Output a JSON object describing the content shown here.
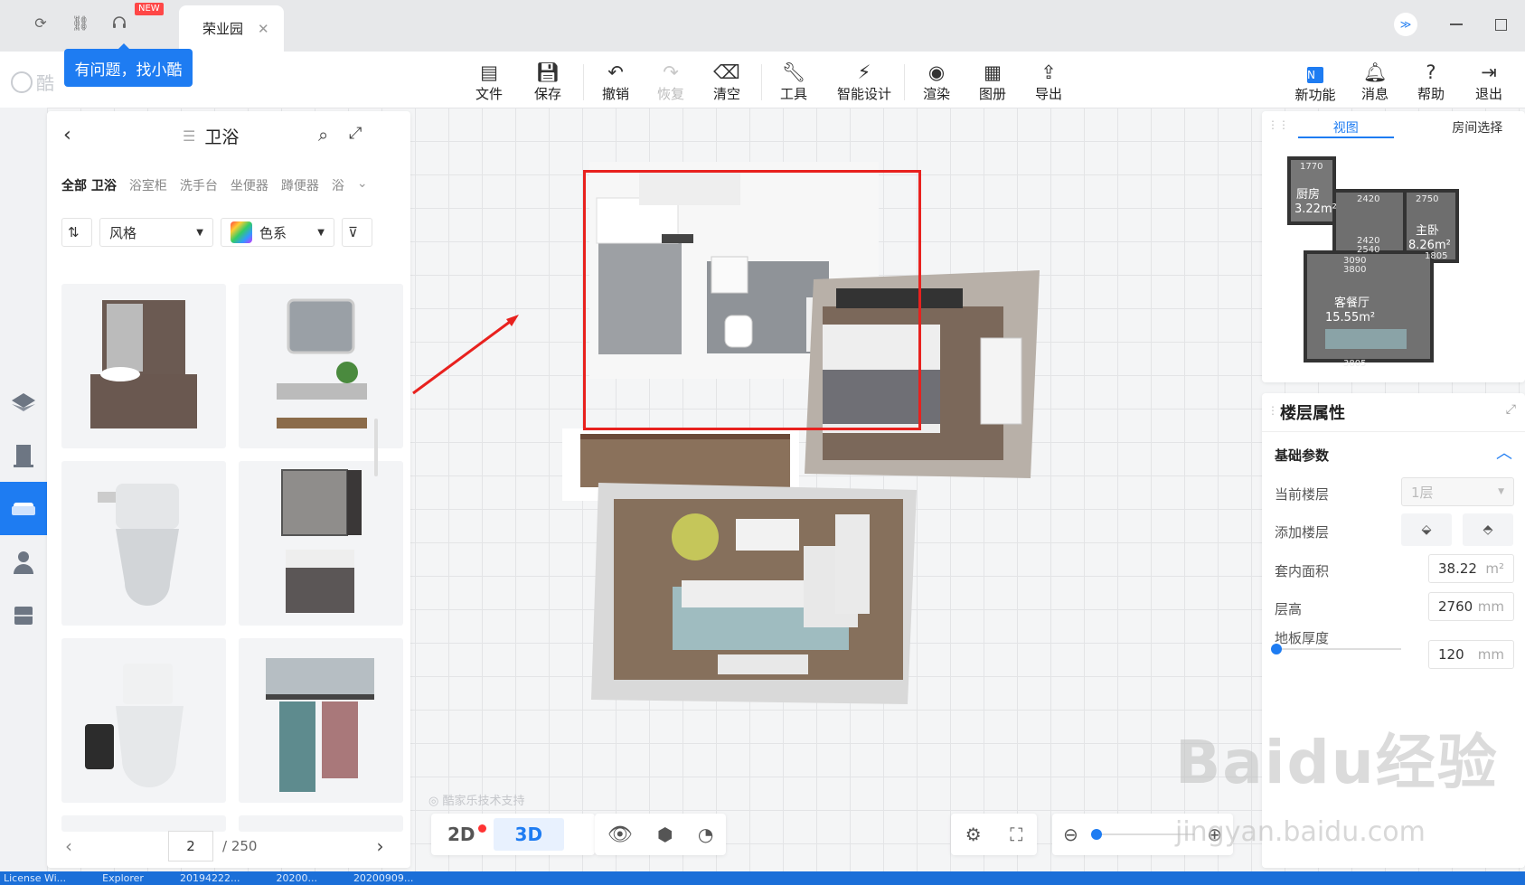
{
  "titlebar": {
    "new_badge": "NEW",
    "tab_title": "荣业园",
    "tooltip": "有问题，找小酷",
    "logo_text": "酷"
  },
  "toolbar": {
    "file": "文件",
    "save": "保存",
    "undo": "撤销",
    "redo": "恢复",
    "clear": "清空",
    "tools": "工具",
    "smart_design": "智能设计",
    "render": "渲染",
    "album": "图册",
    "export": "导出",
    "new_features": "新功能",
    "messages": "消息",
    "help": "帮助",
    "logout": "退出"
  },
  "catalog": {
    "title": "卫浴",
    "subtabs": [
      "全部 卫浴",
      "浴室柜",
      "洗手台",
      "坐便器",
      "蹲便器",
      "浴"
    ],
    "style_filter": "风格",
    "color_filter": "色系",
    "page_current": "2",
    "page_total": "/ 250"
  },
  "view": {
    "btn_2d": "2D",
    "btn_3d": "3D",
    "support": "酷家乐技术支持"
  },
  "minimap": {
    "tab_view": "视图",
    "tab_room": "房间选择",
    "rooms": [
      {
        "name": "厨房",
        "area": "3.22m²"
      },
      {
        "name": "主卧",
        "area": "8.26m²"
      },
      {
        "name": "客餐厅",
        "area": "15.55m²"
      }
    ],
    "dims": [
      "1770",
      "2420",
      "2750",
      "2420",
      "2540",
      "3090",
      "3800",
      "3805",
      "1805"
    ]
  },
  "props": {
    "title": "楼层属性",
    "section": "基础参数",
    "current_floor_label": "当前楼层",
    "current_floor_value": "1层",
    "add_floor_label": "添加楼层",
    "area_label": "套内面积",
    "area_value": "38.22",
    "area_unit": "m²",
    "height_label": "层高",
    "height_value": "2760",
    "height_unit": "mm",
    "floor_thick_label": "地板厚度",
    "floor_thick_value": "120",
    "floor_thick_unit": "mm"
  },
  "taskbar": [
    "License Wi...",
    "Explorer",
    "20194222...",
    "20200...",
    "20200909..."
  ],
  "watermark": {
    "main": "Baidu经验",
    "sub": "jingyan.baidu.com"
  },
  "colors": {
    "accent": "#1e7cf2",
    "highlight": "#e8211e"
  }
}
